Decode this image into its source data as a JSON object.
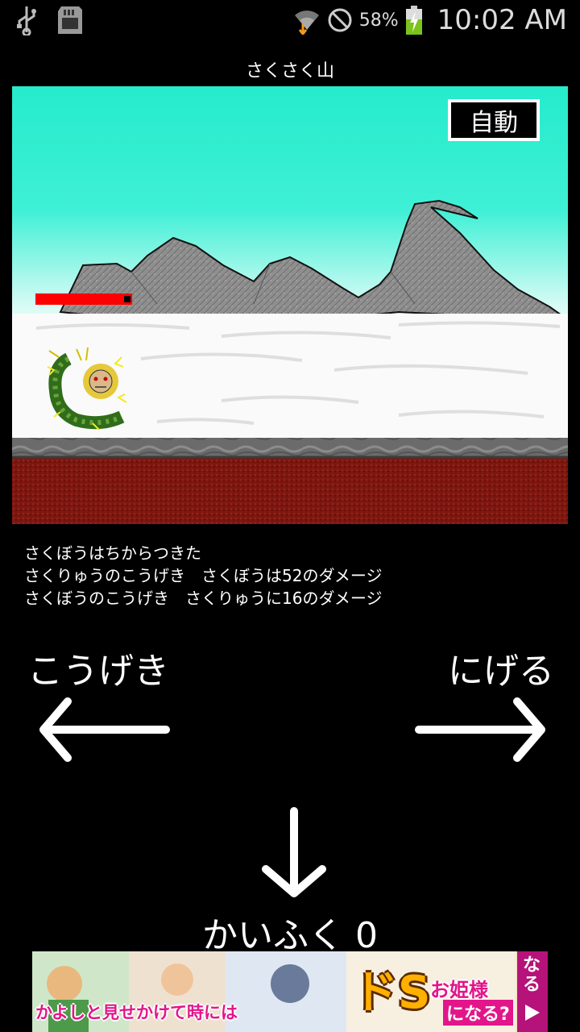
{
  "status_bar": {
    "battery_percent": "58%",
    "time": "10:02 AM",
    "icons": [
      "usb-icon",
      "sd-card-icon",
      "wifi-icon",
      "no-signal-icon",
      "battery-charging-icon"
    ]
  },
  "location": {
    "title": "さくさく山"
  },
  "battle": {
    "auto_button_label": "自動",
    "enemy_hp_fraction": 1.0
  },
  "log": {
    "lines": [
      "さくぼうはちからつきた",
      "さくりゅうのこうげき　さくぼうは52のダメージ",
      "さくぼうのこうげき　さくりゅうに16のダメージ"
    ]
  },
  "commands": {
    "attack_label": "こうげき",
    "flee_label": "にげる",
    "heal_label": "かいふく 0"
  },
  "ad": {
    "text_left": "かよしと見せかけて時には",
    "text_big": "ドS",
    "text_right1": "お姫様",
    "text_right2": "になる?",
    "side_text": "なる"
  },
  "colors": {
    "sky_top": "#25ebcc",
    "hp_bar": "#ff0000",
    "ground": "#8a1a12"
  }
}
